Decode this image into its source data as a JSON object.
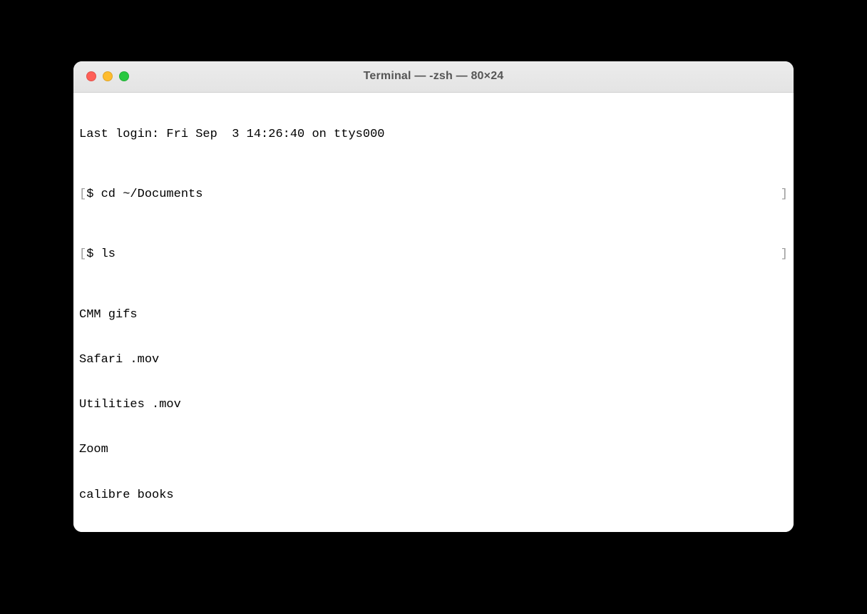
{
  "window": {
    "title": "Terminal — -zsh — 80×24"
  },
  "terminal": {
    "last_login": "Last login: Fri Sep  3 14:26:40 on ttys000",
    "prompt": "$ ",
    "commands": [
      {
        "cmd": "cd ~/Documents"
      },
      {
        "cmd": "ls"
      }
    ],
    "output": [
      "CMM gifs",
      "Safari .mov",
      "Utilities .mov",
      "Zoom",
      "calibre books"
    ],
    "bracket_open": "[",
    "bracket_close": "]"
  }
}
